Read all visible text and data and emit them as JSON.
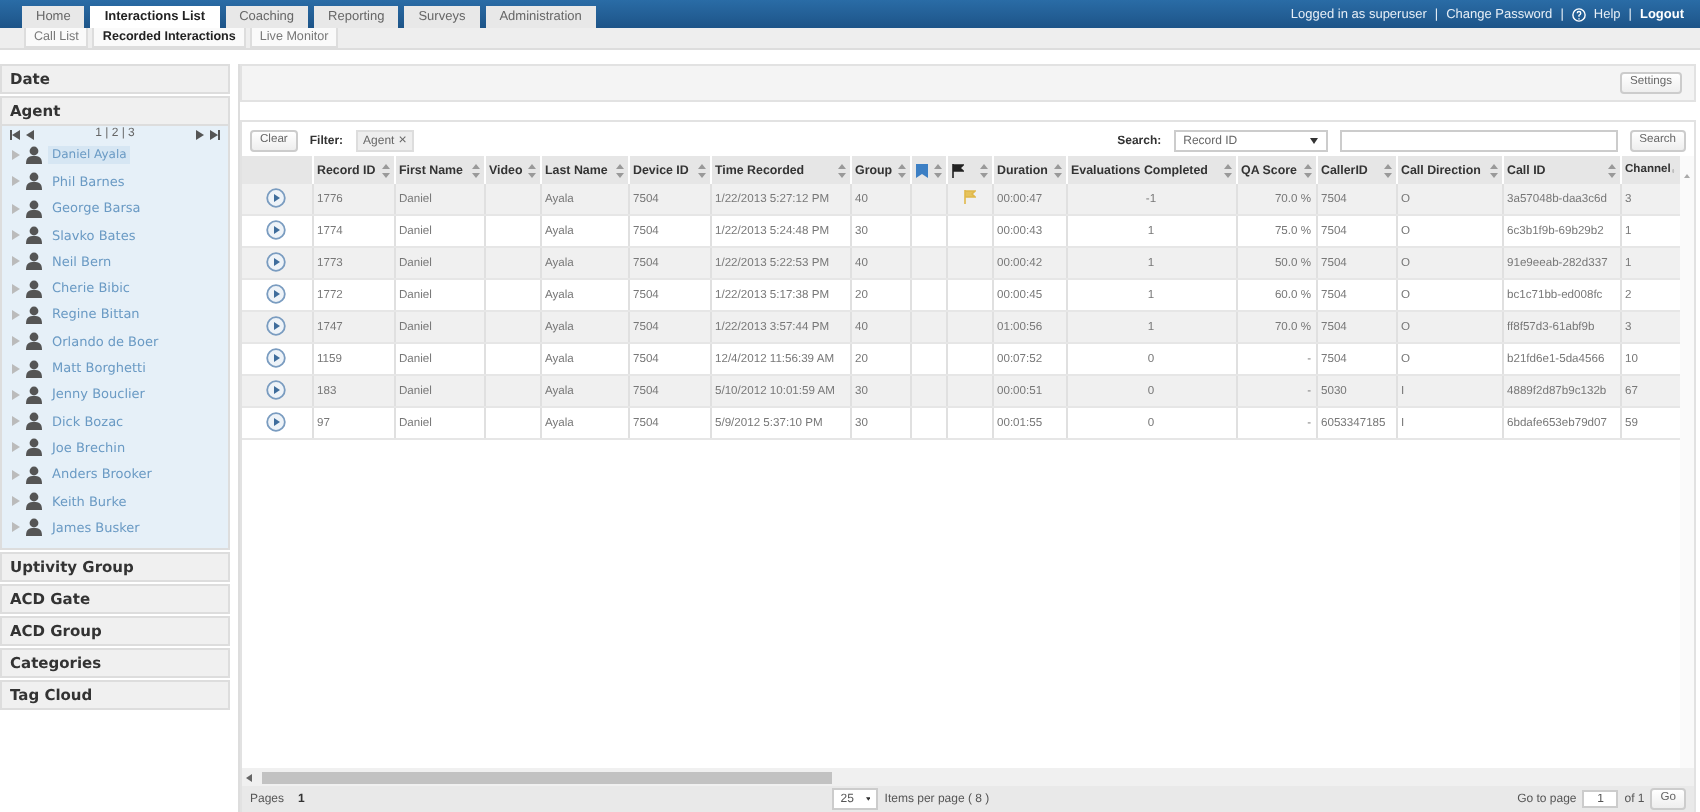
{
  "top_tabs": [
    {
      "label": "Home",
      "selected": false
    },
    {
      "label": "Interactions List",
      "selected": true
    },
    {
      "label": "Coaching",
      "selected": false
    },
    {
      "label": "Reporting",
      "selected": false
    },
    {
      "label": "Surveys",
      "selected": false
    },
    {
      "label": "Administration",
      "selected": false
    }
  ],
  "user_bar": {
    "logged_in": "Logged in as superuser",
    "change_password": "Change Password",
    "help": "Help",
    "logout": "Logout",
    "separator": "|"
  },
  "sub_tabs": [
    {
      "label": "Call List",
      "selected": false
    },
    {
      "label": "Recorded Interactions",
      "selected": true
    },
    {
      "label": "Live Monitor",
      "selected": false
    }
  ],
  "sidebar": {
    "sections_top": [
      "Date"
    ],
    "agent_section": {
      "title": "Agent",
      "pager": "1 | 2 | 3",
      "agents": [
        {
          "name": "Daniel Ayala",
          "selected": true
        },
        {
          "name": "Phil Barnes",
          "selected": false
        },
        {
          "name": "George Barsa",
          "selected": false
        },
        {
          "name": "Slavko Bates",
          "selected": false
        },
        {
          "name": "Neil Bern",
          "selected": false
        },
        {
          "name": "Cherie Bibic",
          "selected": false
        },
        {
          "name": "Regine Bittan",
          "selected": false
        },
        {
          "name": "Orlando de Boer",
          "selected": false
        },
        {
          "name": "Matt Borghetti",
          "selected": false
        },
        {
          "name": "Jenny Bouclier",
          "selected": false
        },
        {
          "name": "Dick Bozac",
          "selected": false
        },
        {
          "name": "Joe Brechin",
          "selected": false
        },
        {
          "name": "Anders Brooker",
          "selected": false
        },
        {
          "name": "Keith Burke",
          "selected": false
        },
        {
          "name": "James Busker",
          "selected": false
        }
      ]
    },
    "sections_bottom": [
      "Uptivity Group",
      "ACD Gate",
      "ACD Group",
      "Categories",
      "Tag Cloud"
    ]
  },
  "toolbar": {
    "settings": "Settings",
    "clear": "Clear",
    "filter_label": "Filter:",
    "filter_chip": "Agent",
    "chip_remove": "×",
    "search_label": "Search:",
    "search_field": "Record ID",
    "search_button": "Search"
  },
  "table": {
    "columns": [
      {
        "kind": "text",
        "label": "Record ID"
      },
      {
        "kind": "text",
        "label": "First Name"
      },
      {
        "kind": "text",
        "label": "Video"
      },
      {
        "kind": "text",
        "label": "Last Name"
      },
      {
        "kind": "text",
        "label": "Device ID"
      },
      {
        "kind": "text",
        "label": "Time Recorded"
      },
      {
        "kind": "text",
        "label": "Group"
      },
      {
        "kind": "bookmark"
      },
      {
        "kind": "flag"
      },
      {
        "kind": "text",
        "label": "Duration"
      },
      {
        "kind": "text",
        "label": "Evaluations Completed"
      },
      {
        "kind": "text",
        "label": "QA Score"
      },
      {
        "kind": "text",
        "label": "CallerID"
      },
      {
        "kind": "text",
        "label": "Call Direction"
      },
      {
        "kind": "text",
        "label": "Call ID"
      },
      {
        "kind": "text",
        "label": "Channel"
      }
    ],
    "rows": [
      {
        "flagged": true,
        "cells": [
          "1776",
          "Daniel",
          "",
          "Ayala",
          "7504",
          "1/22/2013 5:27:12 PM",
          "40",
          "",
          "",
          "00:00:47",
          "-1",
          "70.0 %",
          "7504",
          "O",
          "3a57048b-daa3c6d",
          "3"
        ]
      },
      {
        "flagged": false,
        "cells": [
          "1774",
          "Daniel",
          "",
          "Ayala",
          "7504",
          "1/22/2013 5:24:48 PM",
          "30",
          "",
          "",
          "00:00:43",
          "1",
          "75.0 %",
          "7504",
          "O",
          "6c3b1f9b-69b29b2",
          "1"
        ]
      },
      {
        "flagged": false,
        "cells": [
          "1773",
          "Daniel",
          "",
          "Ayala",
          "7504",
          "1/22/2013 5:22:53 PM",
          "40",
          "",
          "",
          "00:00:42",
          "1",
          "50.0 %",
          "7504",
          "O",
          "91e9eeab-282d337",
          "1"
        ]
      },
      {
        "flagged": false,
        "cells": [
          "1772",
          "Daniel",
          "",
          "Ayala",
          "7504",
          "1/22/2013 5:17:38 PM",
          "20",
          "",
          "",
          "00:00:45",
          "1",
          "60.0 %",
          "7504",
          "O",
          "bc1c71bb-ed008fc",
          "2"
        ]
      },
      {
        "flagged": false,
        "cells": [
          "1747",
          "Daniel",
          "",
          "Ayala",
          "7504",
          "1/22/2013 3:57:44 PM",
          "40",
          "",
          "",
          "01:00:56",
          "1",
          "70.0 %",
          "7504",
          "O",
          "ff8f57d3-61abf9b",
          "3"
        ]
      },
      {
        "flagged": false,
        "cells": [
          "1159",
          "Daniel",
          "",
          "Ayala",
          "7504",
          "12/4/2012 11:56:39 AM",
          "20",
          "",
          "",
          "00:07:52",
          "0",
          "-",
          "7504",
          "O",
          "b21fd6e1-5da4566",
          "10"
        ]
      },
      {
        "flagged": false,
        "cells": [
          "183",
          "Daniel",
          "",
          "Ayala",
          "7504",
          "5/10/2012 10:01:59 AM",
          "30",
          "",
          "",
          "00:00:51",
          "0",
          "-",
          "5030",
          "I",
          "4889f2d87b9c132b",
          "67"
        ]
      },
      {
        "flagged": false,
        "cells": [
          "97",
          "Daniel",
          "",
          "Ayala",
          "7504",
          "5/9/2012 5:37:10 PM",
          "30",
          "",
          "",
          "00:01:55",
          "0",
          "-",
          "6053347185",
          "I",
          "6bdafe653eb79d07",
          "59"
        ]
      }
    ]
  },
  "footer": {
    "pages_label": "Pages",
    "page": "1",
    "per_page": "25",
    "per_page_label": "Items per page ( 8 )",
    "goto_label": "Go to page",
    "goto_value": "1",
    "of": "of 1",
    "go": "Go"
  }
}
